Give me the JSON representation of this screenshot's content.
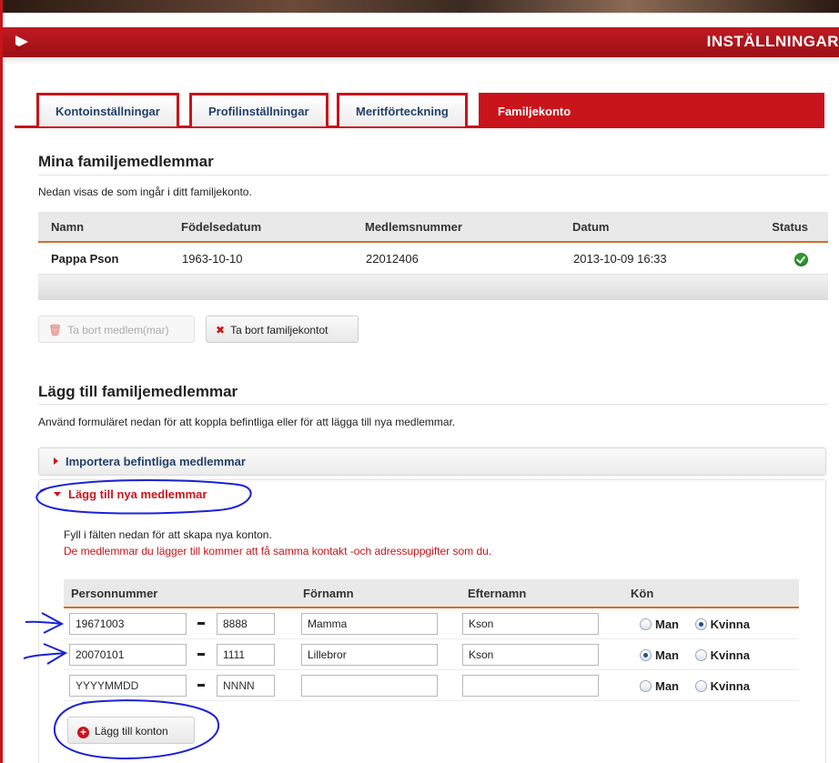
{
  "header": {
    "title": "INSTÄLLNINGAR"
  },
  "tabs": [
    {
      "label": "Kontoinställningar",
      "active": false
    },
    {
      "label": "Profilinställningar",
      "active": false
    },
    {
      "label": "Meritförteckning",
      "active": false
    },
    {
      "label": "Familjekonto",
      "active": true
    }
  ],
  "members_section": {
    "title": "Mina familjemedlemmar",
    "description": "Nedan visas de som ingår i ditt familjekonto.",
    "columns": [
      "Namn",
      "Födelsedatum",
      "Medlemsnummer",
      "Datum",
      "Status"
    ],
    "rows": [
      {
        "name": "Pappa Pson",
        "birthdate": "1963-10-10",
        "member_no": "22012406",
        "date": "2013-10-09 16:33",
        "status": "ok"
      }
    ],
    "remove_members_label": "Ta bort medlem(mar)",
    "remove_account_label": "Ta bort familjekontot"
  },
  "add_section": {
    "title": "Lägg till familjemedlemmar",
    "description": "Använd formuläret nedan för att koppla befintliga eller för att lägga till nya medlemmar.",
    "import_label": "Importera befintliga medlemmar",
    "new_label": "Lägg till nya medlemmar",
    "instruction": "Fyll i fälten nedan för att skapa nya konton.",
    "warning": "De medlemmar du lägger till kommer att få samma kontakt -och adressuppgifter som du.",
    "columns": [
      "Personnummer",
      "Förnamn",
      "Efternamn",
      "Kön"
    ],
    "gender_options": [
      "Man",
      "Kvinna"
    ],
    "rows": [
      {
        "pnr_date": "19671003",
        "pnr_suffix": "8888",
        "first_name": "Mamma",
        "last_name": "Kson",
        "gender": "Kvinna"
      },
      {
        "pnr_date": "20070101",
        "pnr_suffix": "1111",
        "first_name": "Lillebror",
        "last_name": "Kson",
        "gender": "Man"
      },
      {
        "pnr_date": "YYYYMMDD",
        "pnr_suffix": "NNNN",
        "first_name": "",
        "last_name": "",
        "gender": ""
      }
    ],
    "submit_label": "Lägg till konton"
  },
  "colors": {
    "brand_red": "#c9141b",
    "link_blue": "#24406b",
    "annotation_blue": "#1a22d6"
  }
}
